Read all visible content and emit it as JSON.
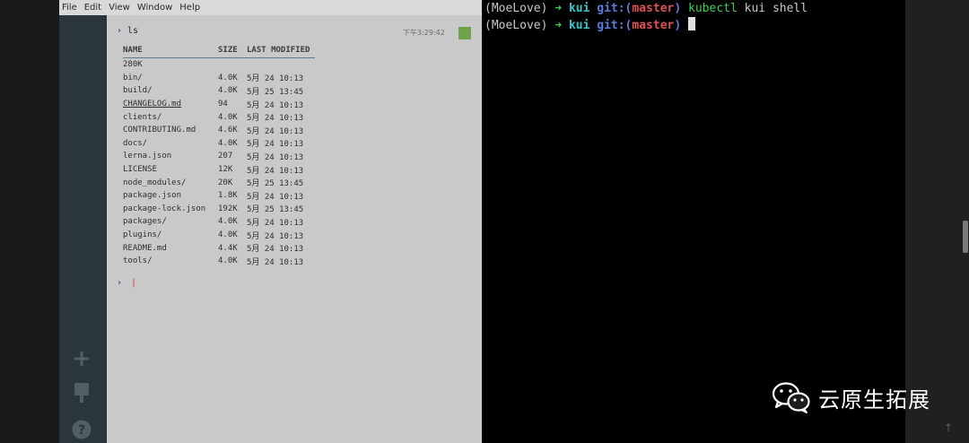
{
  "menu": {
    "items": [
      "File",
      "Edit",
      "View",
      "Window",
      "Help"
    ]
  },
  "kui": {
    "prompt_command": "ls",
    "timestamp": "下午3:29:42",
    "headers": {
      "name": "NAME",
      "size": "SIZE",
      "modified": "LAST MODIFIED"
    },
    "total": "280K",
    "rows": [
      {
        "name": "bin/",
        "size": "4.0K",
        "modified": "5月 24 10:13",
        "kind": "dir"
      },
      {
        "name": "build/",
        "size": "4.0K",
        "modified": "5月 25 13:45",
        "kind": "dir"
      },
      {
        "name": "CHANGELOG.md",
        "size": "94",
        "modified": "5月 24 10:13",
        "kind": "link"
      },
      {
        "name": "clients/",
        "size": "4.0K",
        "modified": "5月 24 10:13",
        "kind": "dir"
      },
      {
        "name": "CONTRIBUTING.md",
        "size": "4.6K",
        "modified": "5月 24 10:13",
        "kind": "file"
      },
      {
        "name": "docs/",
        "size": "4.0K",
        "modified": "5月 24 10:13",
        "kind": "dir"
      },
      {
        "name": "lerna.json",
        "size": "207",
        "modified": "5月 24 10:13",
        "kind": "file"
      },
      {
        "name": "LICENSE",
        "size": "12K",
        "modified": "5月 24 10:13",
        "kind": "file"
      },
      {
        "name": "node_modules/",
        "size": "20K",
        "modified": "5月 25 13:45",
        "kind": "dir"
      },
      {
        "name": "package.json",
        "size": "1.8K",
        "modified": "5月 24 10:13",
        "kind": "file"
      },
      {
        "name": "package-lock.json",
        "size": "192K",
        "modified": "5月 25 13:45",
        "kind": "file"
      },
      {
        "name": "packages/",
        "size": "4.0K",
        "modified": "5月 24 10:13",
        "kind": "dir"
      },
      {
        "name": "plugins/",
        "size": "4.0K",
        "modified": "5月 24 10:13",
        "kind": "dir"
      },
      {
        "name": "README.md",
        "size": "4.4K",
        "modified": "5月 24 10:13",
        "kind": "file"
      },
      {
        "name": "tools/",
        "size": "4.0K",
        "modified": "5月 24 10:13",
        "kind": "dir"
      }
    ],
    "sidebar_icons": [
      "plus-icon",
      "paintbrush-icon",
      "help-icon"
    ],
    "colors": {
      "dir": "#2f9a9a",
      "link": "#3a5fa8",
      "status": "#6fa24a"
    }
  },
  "terminal": {
    "line1": {
      "env": "(MoeLove)",
      "arrow": "➜",
      "dir": "kui",
      "git_prefix": "git:(",
      "branch": "master",
      "git_suffix": ")",
      "cmd": "kubectl",
      "args": " kui shell"
    },
    "line2": {
      "env": "(MoeLove)",
      "arrow": "➜",
      "dir": "kui",
      "git_prefix": "git:(",
      "branch": "master",
      "git_suffix": ")"
    }
  },
  "watermark": {
    "text": "云原生拓展",
    "icon": "wechat-icon"
  }
}
